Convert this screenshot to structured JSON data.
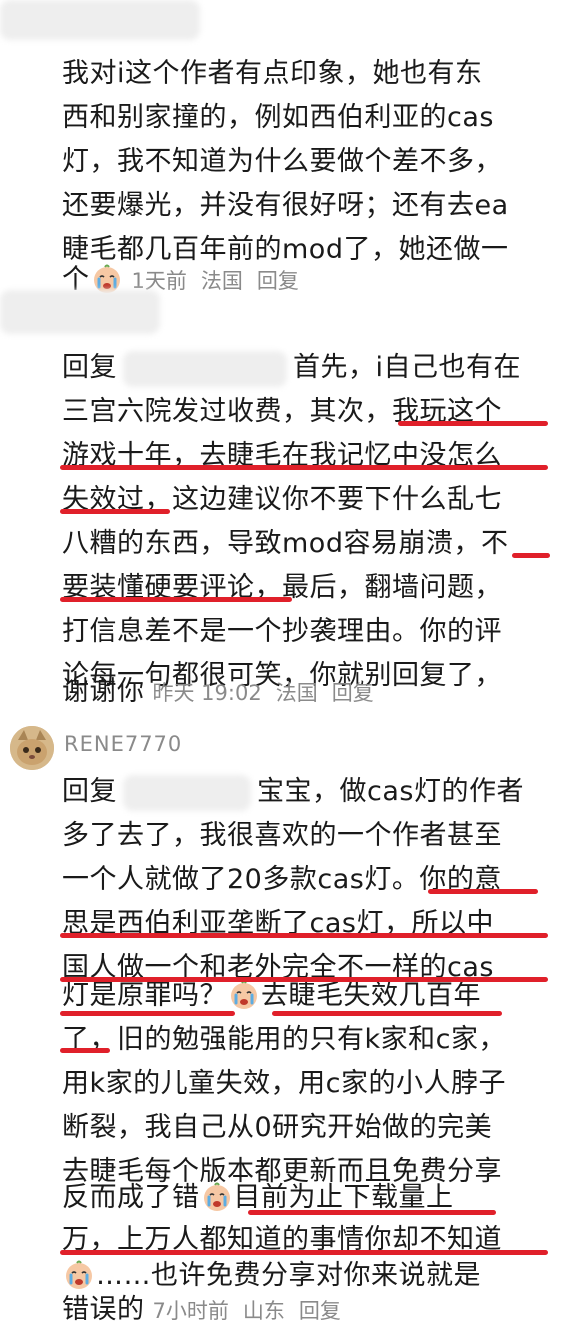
{
  "comment1": {
    "lines": [
      "我对i这个作者有点印象，她也有东",
      "西和别家撞的，例如西伯利亚的cas",
      "灯，我不知道为什么要做个差不多，",
      "还要爆光，并没有很好呀；还有去ea",
      "睫毛都几百年前的mod了，她还做一",
      "个"
    ],
    "emoji": "crying-face",
    "time": "1天前",
    "location": "法国",
    "reply_label": "回复"
  },
  "comment2": {
    "lines": [
      "回复",
      "首先，i自己也有在",
      "三宫六院发过收费，其次，我玩这个",
      "游戏十年，去睫毛在我记忆中没怎么",
      "失效过，这边建议你不要下什么乱七",
      "八糟的东西，导致mod容易崩溃，不",
      "要装懂硬要评论，最后，翻墙问题，",
      "打信息差不是一个抄袭理由。你的评",
      "论每一句都很可笑，你就别回复了，",
      "谢谢你"
    ],
    "time": "昨天 19:02",
    "location": "法国",
    "reply_label": "回复"
  },
  "comment3": {
    "username": "RENE7770",
    "lines": [
      "回复",
      "宝宝，做cas灯的作者",
      "多了去了，我很喜欢的一个作者甚至",
      "一个人就做了20多款cas灯。你的意",
      "思是西伯利亚垄断了cas灯，所以中",
      "国人做一个和老外完全不一样的cas",
      "灯是原罪吗？",
      "去睫毛失效几百年",
      "了，旧的勉强能用的只有k家和c家，",
      "用k家的儿童失效，用c家的小人脖子",
      "断裂，我自己从0研究开始做的完美",
      "去睫毛每个版本都更新而且免费分享",
      "反而成了错",
      "目前为止下载量上",
      "万，上万人都知道的事情你却不知道",
      "……也许免费分享对你来说就是",
      "错误的"
    ],
    "time": "7小时前",
    "location": "山东",
    "reply_label": "回复"
  },
  "colors": {
    "underline": "#e0202a",
    "meta": "#8a8a8a",
    "text": "#1a1a1a"
  }
}
